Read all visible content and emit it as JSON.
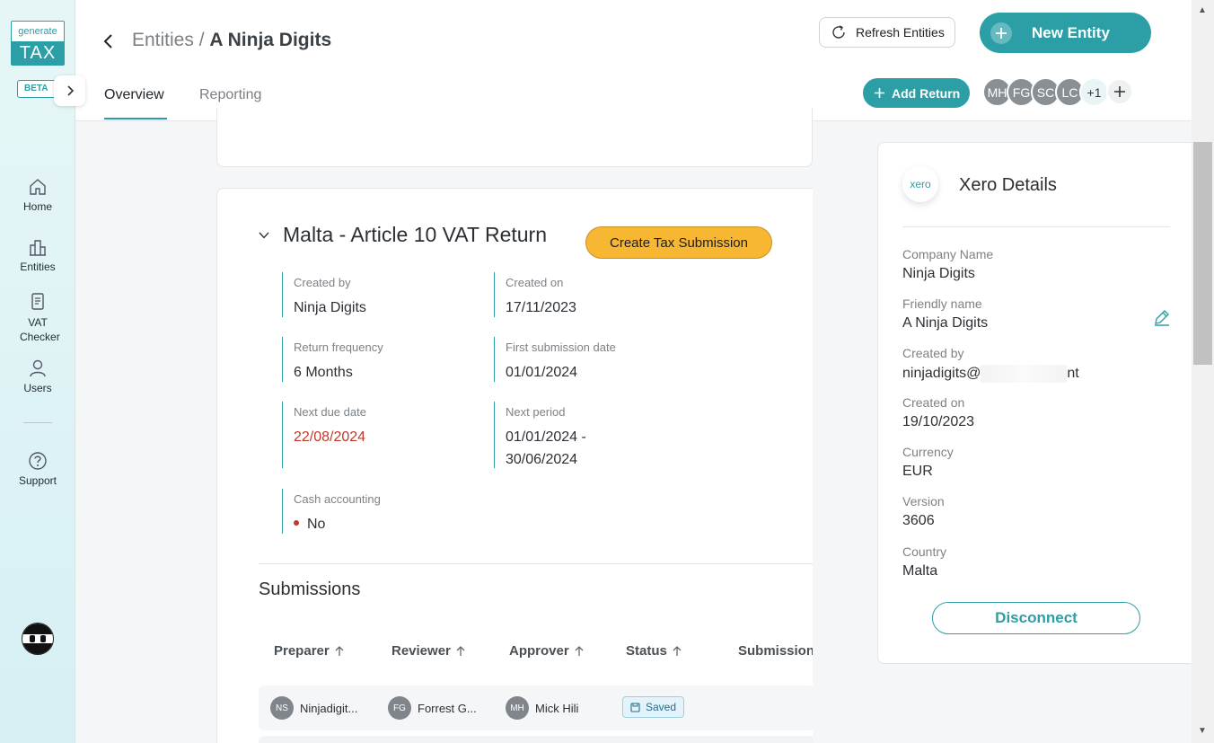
{
  "sidebar": {
    "logo_top": "generate",
    "logo_bottom": "TAX",
    "beta": "BETA",
    "items": [
      {
        "label": "Home"
      },
      {
        "label": "Entities"
      },
      {
        "label": "VAT Checker"
      },
      {
        "label": "Users"
      },
      {
        "label": "Support"
      }
    ]
  },
  "header": {
    "crumb_parent": "Entities",
    "crumb_sep": " / ",
    "crumb_current": "A Ninja Digits",
    "tabs": [
      {
        "label": "Overview"
      },
      {
        "label": "Reporting"
      }
    ],
    "refresh_label": "Refresh Entities",
    "new_entity_label": "New Entity",
    "add_return_label": "Add Return",
    "avatars": [
      "MH",
      "FG",
      "SC",
      "LC"
    ],
    "avatars_more": "+1"
  },
  "return": {
    "title": "Malta - Article 10 VAT Return",
    "create_label": "Create Tax Submission",
    "fields": {
      "created_by_label": "Created by",
      "created_by": "Ninja Digits",
      "created_on_label": "Created on",
      "created_on": "17/11/2023",
      "freq_label": "Return frequency",
      "freq": "6 Months",
      "first_sub_label": "First submission date",
      "first_sub": "01/01/2024",
      "next_due_label": "Next due date",
      "next_due": "22/08/2024",
      "next_period_label": "Next period",
      "next_period_1": "01/01/2024 -",
      "next_period_2": "30/06/2024",
      "cash_label": "Cash accounting",
      "cash": "No"
    }
  },
  "submissions": {
    "title": "Submissions",
    "columns": [
      "Preparer",
      "Reviewer",
      "Approver",
      "Status",
      "Submission"
    ],
    "rows": [
      {
        "preparer_ini": "NS",
        "preparer": "Ninjadigit...",
        "reviewer_ini": "FG",
        "reviewer": "Forrest G...",
        "approver_ini": "MH",
        "approver": "Mick Hili",
        "status": "Saved"
      }
    ]
  },
  "xero": {
    "logo_text": "xero",
    "title": "Xero Details",
    "company_name_label": "Company Name",
    "company_name": "Ninja Digits",
    "friendly_label": "Friendly name",
    "friendly": "A Ninja Digits",
    "created_by_label": "Created by",
    "created_by_start": "ninjadigits@",
    "created_by_end": "nt",
    "created_on_label": "Created on",
    "created_on": "19/10/2023",
    "currency_label": "Currency",
    "currency": "EUR",
    "version_label": "Version",
    "version": "3606",
    "country_label": "Country",
    "country": "Malta",
    "disconnect_label": "Disconnect"
  },
  "colors": {
    "accent": "#2b9fa5",
    "warning": "#f7b733",
    "danger": "#c0392b"
  }
}
